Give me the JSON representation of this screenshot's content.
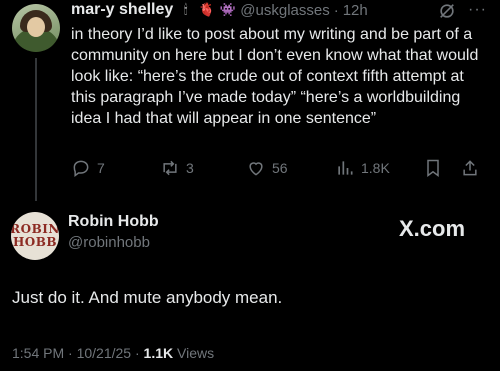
{
  "parent_post": {
    "display_name": "mar-y shelley",
    "name_emojis": [
      "candle-emoji",
      "anatomical-heart-emoji",
      "monster-emoji"
    ],
    "handle": "@uskglasses",
    "separator": "·",
    "time": "12h",
    "text": "in theory I’d like to post about my writing and be part of a community on here but I don’t even know what that would look like: “here’s the crude out of context fifth attempt at this paragraph I’ve made today” “here’s a worldbuilding idea I had that will appear in one sentence”",
    "replies": "7",
    "reposts": "3",
    "likes": "56",
    "views": "1.8K",
    "more_label": "···"
  },
  "reply_post": {
    "avatar_text_line1": "ROBIN",
    "avatar_text_line2": "HOBB",
    "display_name": "Robin Hobb",
    "handle": "@robinhobb",
    "text": "Just do it. And mute anybody mean.",
    "time": "1:54 PM",
    "date": "10/21/25",
    "separator": "·",
    "views_count": "1.1K",
    "views_label": "Views"
  },
  "watermark": "X.com",
  "colors": {
    "background": "#000000",
    "primary_text": "#e7e9ea",
    "secondary_text": "#71767b"
  }
}
